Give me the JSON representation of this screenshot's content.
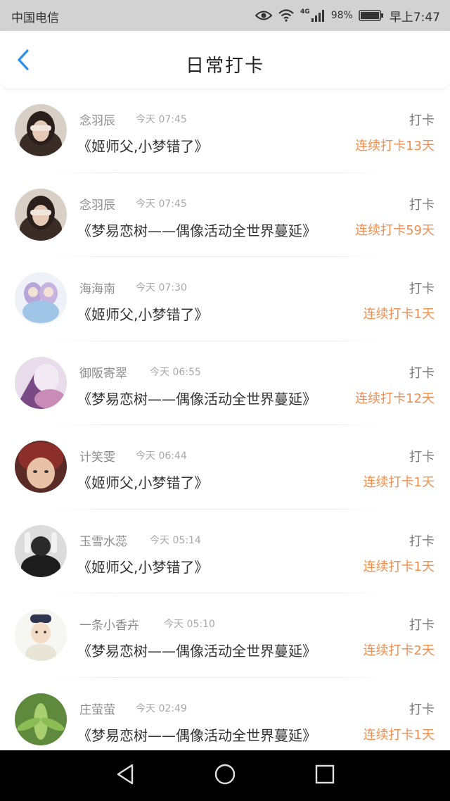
{
  "status_bar": {
    "carrier": "中国电信",
    "network": "4G",
    "battery": "98%",
    "time": "早上7:47",
    "icons": [
      "eye-icon",
      "wifi-icon",
      "signal-icon",
      "battery-icon"
    ]
  },
  "header": {
    "title": "日常打卡",
    "back_icon": "chevron-left-icon"
  },
  "checkins": [
    {
      "name": "念羽辰",
      "time": "今天 07:45",
      "action": "打卡",
      "course": "《姬师父,小梦错了》",
      "streak": "连续打卡13天"
    },
    {
      "name": "念羽辰",
      "time": "今天 07:45",
      "action": "打卡",
      "course": "《梦易恋树——偶像活动全世界蔓延》",
      "streak": "连续打卡59天"
    },
    {
      "name": "海海南",
      "time": "今天 07:30",
      "action": "打卡",
      "course": "《姬师父,小梦错了》",
      "streak": "连续打卡1天"
    },
    {
      "name": "御阪寄翠",
      "time": "今天 06:55",
      "action": "打卡",
      "course": "《梦易恋树——偶像活动全世界蔓延》",
      "streak": "连续打卡12天"
    },
    {
      "name": "计笑雯",
      "time": "今天 06:44",
      "action": "打卡",
      "course": "《姬师父,小梦错了》",
      "streak": "连续打卡1天"
    },
    {
      "name": "玉雪水蕊",
      "time": "今天 05:14",
      "action": "打卡",
      "course": "《姬师父,小梦错了》",
      "streak": "连续打卡1天"
    },
    {
      "name": "一条小香卉",
      "time": "今天 05:10",
      "action": "打卡",
      "course": "《梦易恋树——偶像活动全世界蔓延》",
      "streak": "连续打卡2天"
    },
    {
      "name": "庄萤萤",
      "time": "今天 02:49",
      "action": "打卡",
      "course": "《梦易恋树——偶像活动全世界蔓延》",
      "streak": "连续打卡1天"
    }
  ],
  "system_nav": {
    "back": "triangle-back-icon",
    "home": "circle-home-icon",
    "recents": "square-recents-icon"
  },
  "colors": {
    "accent": "#2b8ff0",
    "streak": "#ef8e4f",
    "status_bar_bg": "#d2d2d2",
    "nav_bar_bg": "#000000"
  }
}
